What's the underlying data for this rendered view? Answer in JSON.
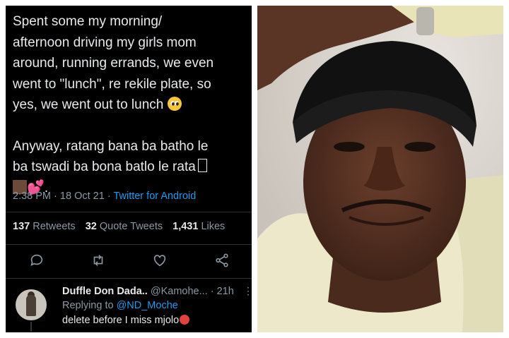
{
  "tweet": {
    "lines": [
      "Spent some my morning/",
      "afternoon driving my girls mom",
      "around, running errands, we even",
      "went to \"lunch\", re rekile plate, so",
      "yes, we went out to lunch"
    ],
    "lines2": [
      "Anyway, ratang bana ba batho le",
      "ba tswadi ba bona batlo le rata"
    ],
    "line3_end": ".",
    "time": "2:38 PM",
    "date": "18 Oct 21",
    "source": "Twitter for Android",
    "sep": "·"
  },
  "stats": {
    "retweets_count": "137",
    "retweets_label": "Retweets",
    "quotes_count": "32",
    "quotes_label": "Quote Tweets",
    "likes_count": "1,431",
    "likes_label": "Likes"
  },
  "icons": {
    "reply": "reply-icon",
    "retweet": "retweet-icon",
    "like": "heart-icon",
    "share": "share-icon"
  },
  "reply": {
    "name": "Duffle Don Dada..",
    "handle": "@Kamohe...",
    "age": "21h",
    "replying_prefix": "Replying to",
    "mention": "@ND_Moche",
    "body": "delete before I miss mjolo"
  },
  "colors": {
    "background": "#000000",
    "text": "#e7e9ea",
    "muted": "#8b98a5",
    "link": "#1d9bf0"
  }
}
